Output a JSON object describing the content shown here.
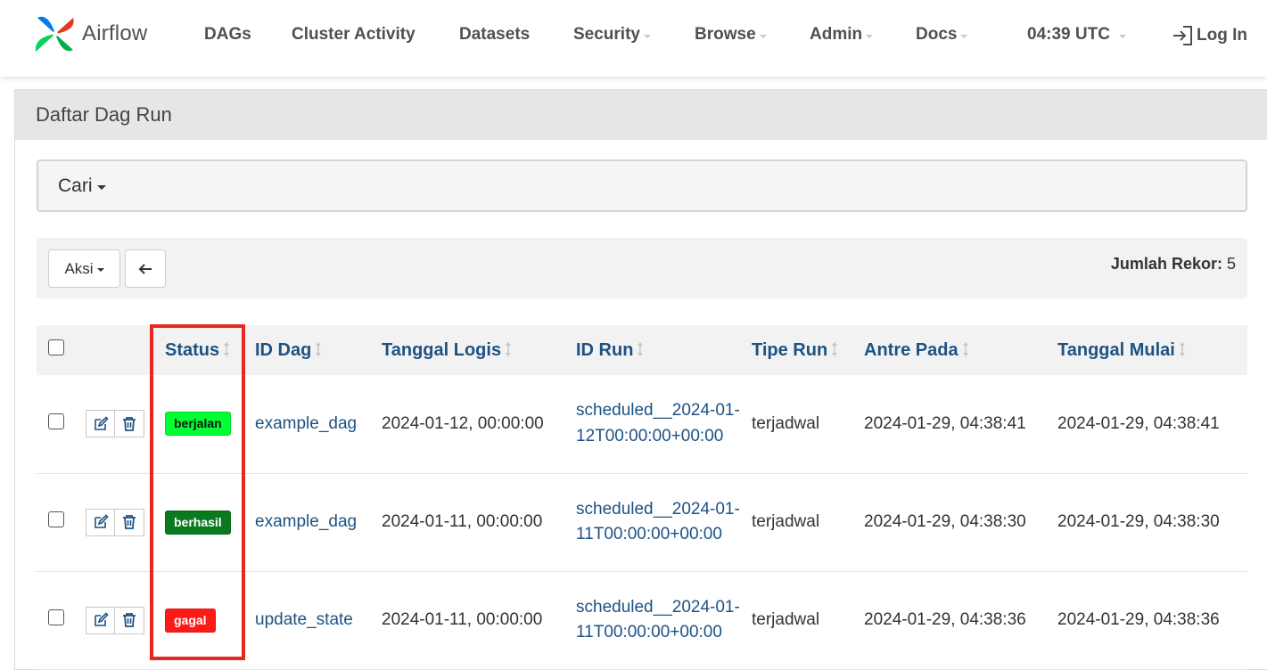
{
  "navbar": {
    "brand": "Airflow",
    "items": [
      {
        "label": "DAGs",
        "dropdown": false
      },
      {
        "label": "Cluster Activity",
        "dropdown": false
      },
      {
        "label": "Datasets",
        "dropdown": false
      },
      {
        "label": "Security",
        "dropdown": true
      },
      {
        "label": "Browse",
        "dropdown": true
      },
      {
        "label": "Admin",
        "dropdown": true
      },
      {
        "label": "Docs",
        "dropdown": true
      }
    ],
    "clock": "04:39 UTC",
    "login": "Log In"
  },
  "panel": {
    "title": "Daftar Dag Run",
    "search_label": "Cari",
    "actions_label": "Aksi",
    "back_icon": "arrow-left-icon",
    "record_count_label": "Jumlah Rekor:",
    "record_count": "5"
  },
  "table": {
    "columns": [
      "Status",
      "ID Dag",
      "Tanggal Logis",
      "ID Run",
      "Tipe Run",
      "Antre Pada",
      "Tanggal Mulai"
    ],
    "rows": [
      {
        "status": "berjalan",
        "dag_id": "example_dag",
        "logical_date": "2024-01-12, 00:00:00",
        "run_id": "scheduled__2024-01-12T00:00:00+00:00",
        "run_type": "terjadwal",
        "queued_at": "2024-01-29, 04:38:41",
        "start_date": "2024-01-29, 04:38:41"
      },
      {
        "status": "berhasil",
        "dag_id": "example_dag",
        "logical_date": "2024-01-11, 00:00:00",
        "run_id": "scheduled__2024-01-11T00:00:00+00:00",
        "run_type": "terjadwal",
        "queued_at": "2024-01-29, 04:38:30",
        "start_date": "2024-01-29, 04:38:30"
      },
      {
        "status": "gagal",
        "dag_id": "update_state",
        "logical_date": "2024-01-11, 00:00:00",
        "run_id": "scheduled__2024-01-11T00:00:00+00:00",
        "run_type": "terjadwal",
        "queued_at": "2024-01-29, 04:38:36",
        "start_date": "2024-01-29, 04:38:36"
      }
    ]
  },
  "colors": {
    "link": "#1d5283",
    "running": "#00ff33",
    "success": "#0a7a1e",
    "failed": "#ff1a1a",
    "highlight": "#e8281e"
  }
}
